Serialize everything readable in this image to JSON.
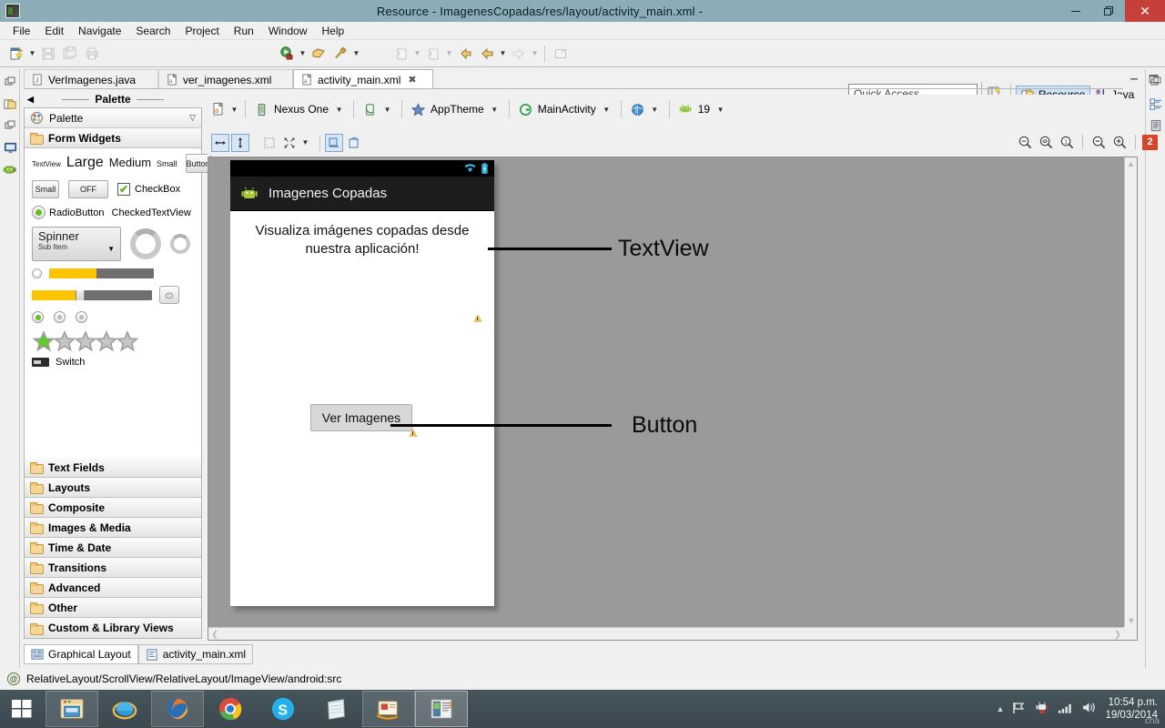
{
  "window": {
    "title": "Resource - ImagenesCopadas/res/layout/activity_main.xml -",
    "app_icon": "eclipse-icon",
    "minimize": "–",
    "maximize": "❐",
    "close": "✕"
  },
  "menubar": {
    "items": [
      "File",
      "Edit",
      "Navigate",
      "Search",
      "Project",
      "Run",
      "Window",
      "Help"
    ]
  },
  "toolbar": {
    "quick_access_placeholder": "Quick Access",
    "perspective_active": "Resource",
    "perspective_other": "Java"
  },
  "editor_tabs": [
    {
      "label": "VerImagenes.java",
      "icon": "java-file-icon",
      "active": false
    },
    {
      "label": "ver_imagenes.xml",
      "icon": "xml-file-icon",
      "active": false
    },
    {
      "label": "activity_main.xml",
      "icon": "xml-file-icon",
      "active": true,
      "close": "✖"
    }
  ],
  "palette": {
    "header": "Palette",
    "title": "Palette",
    "group_open": "Form Widgets",
    "widgets": {
      "textview": "TextView",
      "large": "Large",
      "medium": "Medium",
      "small": "Small",
      "button": "Button",
      "small_button": "Small",
      "toggle": "OFF",
      "checkbox": "CheckBox",
      "radiobutton": "RadioButton",
      "checkedtextview": "CheckedTextView",
      "spinner": "Spinner",
      "spinner_sub": "Sub Item",
      "switch": "Switch"
    },
    "groups": [
      "Text Fields",
      "Layouts",
      "Composite",
      "Images & Media",
      "Time & Date",
      "Transitions",
      "Advanced",
      "Other",
      "Custom & Library Views"
    ]
  },
  "canvas_toolbar": {
    "config_label": "",
    "device": "Nexus One",
    "theme": "AppTheme",
    "activity": "MainActivity",
    "api_level": "19",
    "zoom_badge": "2"
  },
  "preview": {
    "app_title": "Imagenes Copadas",
    "textview_text": "Visualiza imágenes copadas desde nuestra aplicación!",
    "button_text": "Ver Imagenes",
    "callouts": [
      {
        "label": "TextView"
      },
      {
        "label": "Button"
      }
    ]
  },
  "bottom_tabs": [
    {
      "label": "Graphical Layout",
      "active": true
    },
    {
      "label": "activity_main.xml",
      "active": false
    }
  ],
  "statusbar": {
    "path": "RelativeLayout/ScrollView/RelativeLayout/ImageView/android:src"
  },
  "taskbar": {
    "items": [
      "file-explorer-icon",
      "internet-explorer-icon",
      "firefox-icon",
      "chrome-icon",
      "skype-icon",
      "notepad-icon",
      "photo-gallery-icon",
      "eclipse-icon"
    ],
    "clock_time": "10:54 p.m.",
    "clock_date": "19/03/2014",
    "watermark": "cha"
  },
  "colors": {
    "titlebar": "#8aadb8",
    "close_button": "#c6403b",
    "canvas_bg": "#9a9a9a",
    "accent_badge": "#d4452c",
    "android_green": "#8cc63f",
    "taskbar": "#3b4850"
  }
}
